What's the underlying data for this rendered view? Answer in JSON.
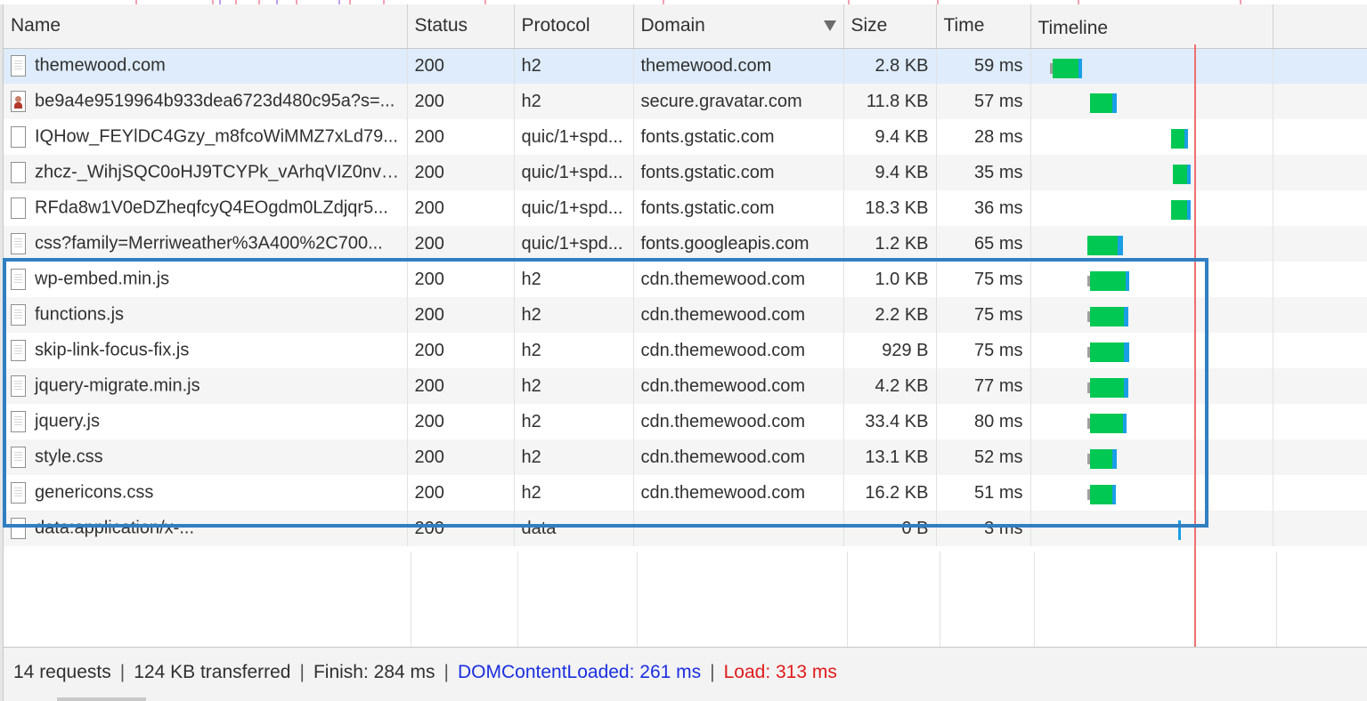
{
  "columns": {
    "name": "Name",
    "status": "Status",
    "protocol": "Protocol",
    "domain": "Domain",
    "size": "Size",
    "time": "Time",
    "timeline": "Timeline"
  },
  "rows": [
    {
      "name": "themewood.com",
      "status": "200",
      "protocol": "h2",
      "domain": "themewood.com",
      "size": "2.8 KB",
      "time": "59 ms",
      "icon": "document-icon"
    },
    {
      "name": "be9a4e9519964b933dea6723d480c95a?s=...",
      "status": "200",
      "protocol": "h2",
      "domain": "secure.gravatar.com",
      "size": "11.8 KB",
      "time": "57 ms",
      "icon": "image-icon"
    },
    {
      "name": "IQHow_FEYlDC4Gzy_m8fcoWiMMZ7xLd79...",
      "status": "200",
      "protocol": "quic/1+spd...",
      "domain": "fonts.gstatic.com",
      "size": "9.4 KB",
      "time": "28 ms",
      "icon": "blank-file-icon"
    },
    {
      "name": "zhcz-_WihjSQC0oHJ9TCYPk_vArhqVIZ0nv9...",
      "status": "200",
      "protocol": "quic/1+spd...",
      "domain": "fonts.gstatic.com",
      "size": "9.4 KB",
      "time": "35 ms",
      "icon": "blank-file-icon"
    },
    {
      "name": "RFda8w1V0eDZheqfcyQ4EOgdm0LZdjqr5...",
      "status": "200",
      "protocol": "quic/1+spd...",
      "domain": "fonts.gstatic.com",
      "size": "18.3 KB",
      "time": "36 ms",
      "icon": "blank-file-icon"
    },
    {
      "name": "css?family=Merriweather%3A400%2C700...",
      "status": "200",
      "protocol": "quic/1+spd...",
      "domain": "fonts.googleapis.com",
      "size": "1.2 KB",
      "time": "65 ms",
      "icon": "document-icon"
    },
    {
      "name": "wp-embed.min.js",
      "status": "200",
      "protocol": "h2",
      "domain": "cdn.themewood.com",
      "size": "1.0 KB",
      "time": "75 ms",
      "icon": "document-icon"
    },
    {
      "name": "functions.js",
      "status": "200",
      "protocol": "h2",
      "domain": "cdn.themewood.com",
      "size": "2.2 KB",
      "time": "75 ms",
      "icon": "document-icon"
    },
    {
      "name": "skip-link-focus-fix.js",
      "status": "200",
      "protocol": "h2",
      "domain": "cdn.themewood.com",
      "size": "929 B",
      "time": "75 ms",
      "icon": "document-icon"
    },
    {
      "name": "jquery-migrate.min.js",
      "status": "200",
      "protocol": "h2",
      "domain": "cdn.themewood.com",
      "size": "4.2 KB",
      "time": "77 ms",
      "icon": "document-icon"
    },
    {
      "name": "jquery.js",
      "status": "200",
      "protocol": "h2",
      "domain": "cdn.themewood.com",
      "size": "33.4 KB",
      "time": "80 ms",
      "icon": "document-icon"
    },
    {
      "name": "style.css",
      "status": "200",
      "protocol": "h2",
      "domain": "cdn.themewood.com",
      "size": "13.1 KB",
      "time": "52 ms",
      "icon": "document-icon"
    },
    {
      "name": "genericons.css",
      "status": "200",
      "protocol": "h2",
      "domain": "cdn.themewood.com",
      "size": "16.2 KB",
      "time": "51 ms",
      "icon": "document-icon"
    },
    {
      "name": "data:application/x-...",
      "status": "200",
      "protocol": "data",
      "domain": "",
      "size": "0 B",
      "time": "3 ms",
      "icon": "blank-file-icon"
    }
  ],
  "timeline_bars": [
    {
      "start": 0.08,
      "wait": 0.01,
      "green": 0.105,
      "blue": 0.015
    },
    {
      "start": 0.245,
      "wait": 0.0,
      "green": 0.09,
      "blue": 0.02
    },
    {
      "start": 0.58,
      "wait": 0.0,
      "green": 0.055,
      "blue": 0.015
    },
    {
      "start": 0.585,
      "wait": 0.0,
      "green": 0.06,
      "blue": 0.015
    },
    {
      "start": 0.58,
      "wait": 0.0,
      "green": 0.065,
      "blue": 0.015
    },
    {
      "start": 0.235,
      "wait": 0.0,
      "green": 0.125,
      "blue": 0.02
    },
    {
      "start": 0.235,
      "wait": 0.01,
      "green": 0.145,
      "blue": 0.015
    },
    {
      "start": 0.235,
      "wait": 0.01,
      "green": 0.14,
      "blue": 0.015
    },
    {
      "start": 0.235,
      "wait": 0.01,
      "green": 0.14,
      "blue": 0.02
    },
    {
      "start": 0.235,
      "wait": 0.01,
      "green": 0.14,
      "blue": 0.015
    },
    {
      "start": 0.235,
      "wait": 0.01,
      "green": 0.135,
      "blue": 0.015
    },
    {
      "start": 0.235,
      "wait": 0.01,
      "green": 0.09,
      "blue": 0.02
    },
    {
      "start": 0.235,
      "wait": 0.01,
      "green": 0.09,
      "blue": 0.015
    },
    {
      "start": 0.61,
      "wait": 0.0,
      "green": 0.0,
      "blue": 0.01
    }
  ],
  "status_bar": {
    "requests": "14 requests",
    "transferred": "124 KB transferred",
    "finish": "Finish: 284 ms",
    "dom_content_loaded": "DOMContentLoaded: 261 ms",
    "load": "Load: 313 ms",
    "separator": "|"
  },
  "colors": {
    "selected_row": "#deecfb",
    "highlight_box": "#2f7fc2",
    "bar_green": "#00c853",
    "bar_blue": "#1a9fe6",
    "load_line": "#f07070",
    "dom_content_loaded": "#1a2fe0",
    "load": "#e01a1a"
  }
}
